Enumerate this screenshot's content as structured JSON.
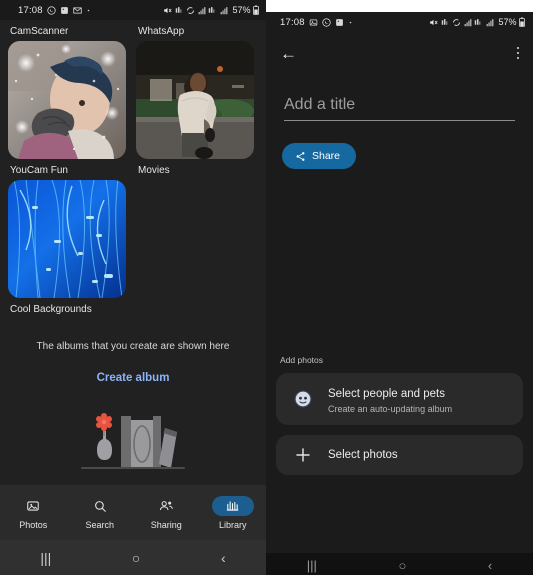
{
  "left": {
    "status_bar": {
      "time": "17:08",
      "battery_percent": "57%",
      "icons": [
        "whatsapp-icon",
        "app-icon",
        "message-icon",
        "dot-icon"
      ],
      "right_icons": [
        "mute-icon",
        "signal-wifi-icon",
        "sync-icon",
        "signal-bars-icon",
        "signal-bars2-icon",
        "signal-bars3-icon",
        "battery-icon"
      ]
    },
    "albums": [
      {
        "label": "CamScanner",
        "label_position": "above",
        "thumb": "winter-portrait-photo"
      },
      {
        "label": "WhatsApp",
        "label_position": "above",
        "thumb": "man-walking-photo"
      },
      {
        "label": "YouCam Fun",
        "label_position": "below",
        "thumb": "winter-portrait-photo"
      },
      {
        "label": "Movies",
        "label_position": "below",
        "thumb": "man-walking-photo"
      },
      {
        "label": "Cool Backgrounds",
        "label_position": "below",
        "thumb": "blue-fiber-optic-photo"
      }
    ],
    "empty_state": {
      "message": "The albums that you create are shown here",
      "action": "Create album",
      "illustration": "books-and-vase-illustration"
    },
    "bottom_nav": {
      "active": "Library",
      "items": [
        {
          "label": "Photos",
          "icon": "photo-icon"
        },
        {
          "label": "Search",
          "icon": "search-icon"
        },
        {
          "label": "Sharing",
          "icon": "people-icon"
        },
        {
          "label": "Library",
          "icon": "library-icon"
        }
      ]
    },
    "system_nav": {
      "recents": "|||",
      "home": "○",
      "back": "‹"
    }
  },
  "right": {
    "status_bar": {
      "time": "17:08",
      "battery_percent": "57%"
    },
    "appbar": {
      "back": "←",
      "overflow": "more-options"
    },
    "title_field": {
      "value": "",
      "placeholder": "Add a title"
    },
    "share_button": {
      "label": "Share",
      "icon": "share-icon",
      "color": "#1668a0"
    },
    "add_photos": {
      "section_label": "Add photos",
      "options": [
        {
          "title": "Select people and pets",
          "subtitle": "Create an auto-updating album",
          "icon": "face-icon"
        },
        {
          "title": "Select photos",
          "subtitle": "",
          "icon": "plus-icon"
        }
      ]
    },
    "system_nav": {
      "recents": "|||",
      "home": "○",
      "back": "‹"
    }
  }
}
